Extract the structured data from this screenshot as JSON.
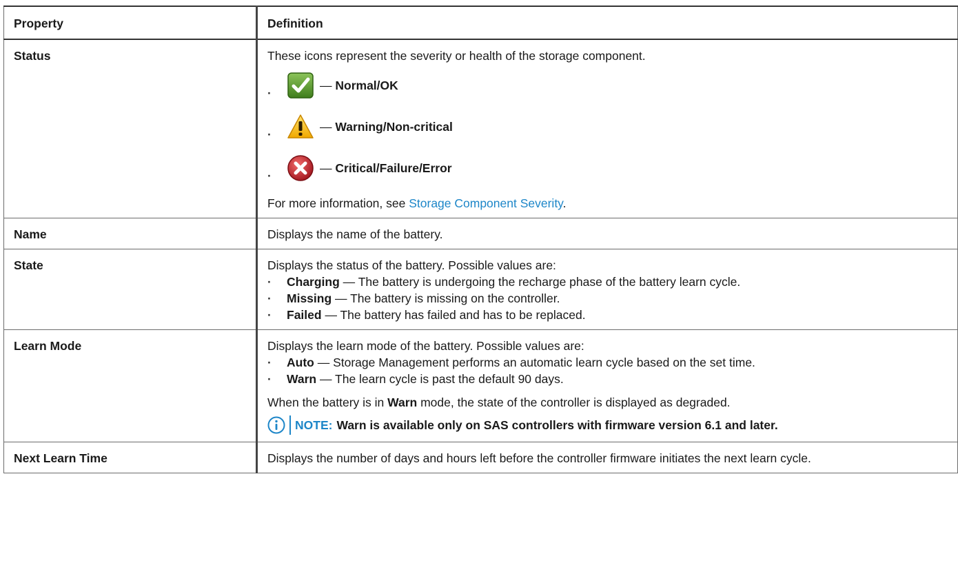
{
  "table": {
    "headers": {
      "property": "Property",
      "definition": "Definition"
    }
  },
  "rows": {
    "status": {
      "property": "Status",
      "intro": "These icons represent the severity or health of the storage component.",
      "icons": [
        {
          "icon": "check-ok-icon",
          "dash": "—",
          "label": "Normal/OK"
        },
        {
          "icon": "warning-triangle-icon",
          "dash": "—",
          "label": "Warning/Non-critical"
        },
        {
          "icon": "critical-x-icon",
          "dash": "—",
          "label": "Critical/Failure/Error"
        }
      ],
      "more_prefix": "For more information, see ",
      "more_link": "Storage Component Severity",
      "more_suffix": "."
    },
    "name": {
      "property": "Name",
      "text": "Displays the name of the battery."
    },
    "state": {
      "property": "State",
      "intro": "Displays the status of the battery. Possible values are:",
      "items": [
        {
          "term": "Charging",
          "text": " — The battery is undergoing the recharge phase of the battery learn cycle."
        },
        {
          "term": "Missing",
          "text": " — The battery is missing on the controller."
        },
        {
          "term": "Failed",
          "text": " — The battery has failed and has to be replaced."
        }
      ]
    },
    "learn_mode": {
      "property": "Learn Mode",
      "intro": "Displays the learn mode of the battery. Possible values are:",
      "items": [
        {
          "term": "Auto",
          "text": " — Storage Management performs an automatic learn cycle based on the set time."
        },
        {
          "term": "Warn",
          "text": " — The learn cycle is past the default 90 days."
        }
      ],
      "warn_prefix": "When the battery is in ",
      "warn_term": "Warn",
      "warn_suffix": " mode, the state of the controller is displayed as degraded.",
      "note_label": "NOTE:",
      "note_text": "Warn is available only on SAS controllers with firmware version 6.1 and later."
    },
    "next_learn": {
      "property": "Next Learn Time",
      "text": "Displays the number of days and hours left before the controller firmware initiates the next learn cycle."
    }
  },
  "colors": {
    "link": "#1d86c8",
    "ok_green": "#5a9a2c",
    "warn_yellow": "#f2b90c",
    "critical_red": "#c8202a"
  }
}
